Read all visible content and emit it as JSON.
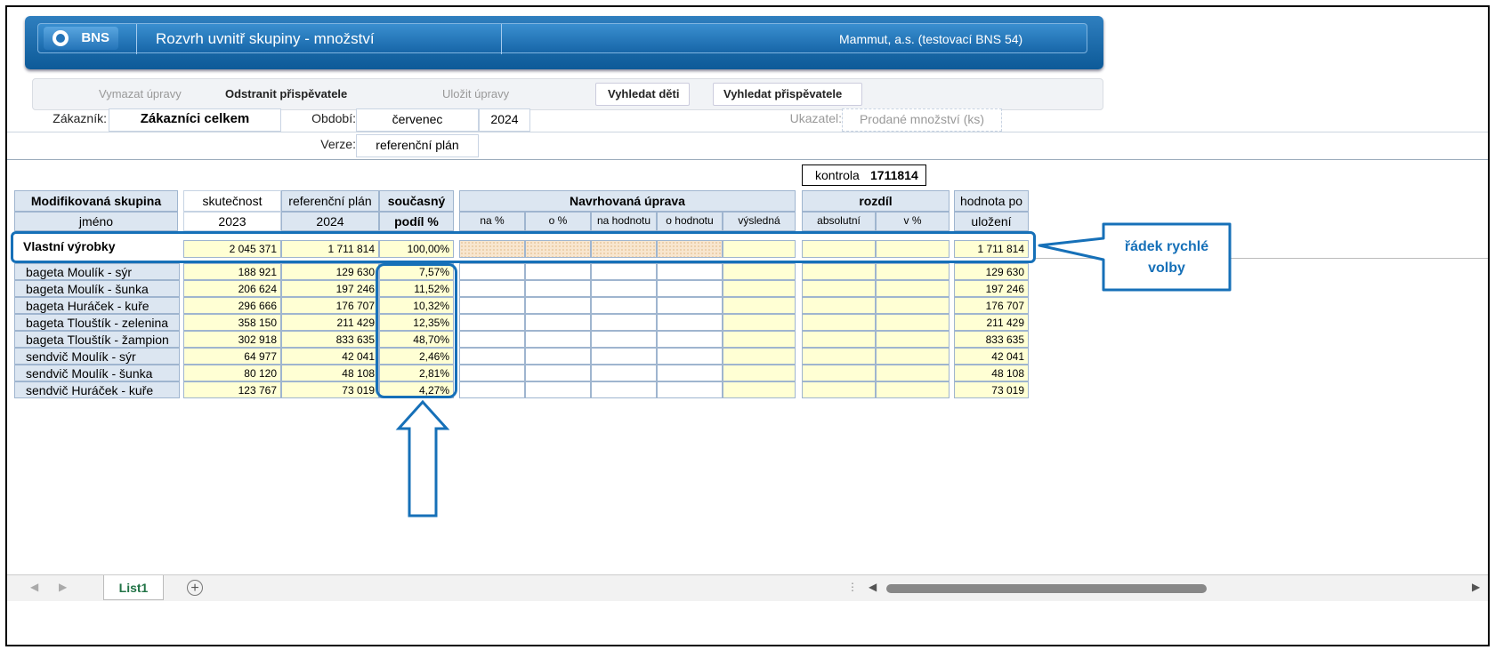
{
  "header": {
    "logo_text": "BNS",
    "app_title": "Rozvrh uvnitř skupiny - množství",
    "company": "Mammut, a.s. (testovací BNS 54)"
  },
  "toolbar": {
    "clear": "Vymazat úpravy",
    "remove_contrib": "Odstranit přispěvatele",
    "save": "Uložit úpravy",
    "find_children": "Vyhledat děti",
    "find_contrib": "Vyhledat přispěvatele"
  },
  "form": {
    "customer_label": "Zákazník:",
    "customer_value": "Zákazníci celkem",
    "period_label": "Období:",
    "period_month": "červenec",
    "period_year": "2024",
    "indicator_label": "Ukazatel:",
    "indicator_value": "Prodané množství (ks)",
    "version_label": "Verze:",
    "version_value": "referenční plán"
  },
  "control": {
    "label": "kontrola",
    "value": "1711814"
  },
  "table": {
    "headers": {
      "group": "Modifikovaná skupina",
      "name": "jméno",
      "actual": "skutečnost",
      "actual_year": "2023",
      "ref_plan": "referenční plán",
      "ref_year": "2024",
      "share": "současný",
      "share2": "podíl %",
      "proposed": "Navrhovaná úprava",
      "na_pct": "na %",
      "o_pct": "o %",
      "na_val": "na hodnotu",
      "o_val": "o hodnotu",
      "result": "výsledná",
      "diff": "rozdíl",
      "absolute": "absolutní",
      "v_pct": "v %",
      "after_save": "hodnota po",
      "after_save2": "uložení"
    },
    "quick_row": {
      "name": "Vlastní výrobky",
      "actual": "2 045 371",
      "ref": "1 711 814",
      "share": "100,00%",
      "after": "1 711 814"
    },
    "rows": [
      {
        "name": "bageta Moulík - sýr",
        "actual": "188 921",
        "ref": "129 630",
        "share": "7,57%",
        "after": "129 630"
      },
      {
        "name": "bageta Moulík - šunka",
        "actual": "206 624",
        "ref": "197 246",
        "share": "11,52%",
        "after": "197 246"
      },
      {
        "name": "bageta Huráček - kuře",
        "actual": "296 666",
        "ref": "176 707",
        "share": "10,32%",
        "after": "176 707"
      },
      {
        "name": "bageta Tlouštík - zelenina",
        "actual": "358 150",
        "ref": "211 429",
        "share": "12,35%",
        "after": "211 429"
      },
      {
        "name": "bageta Tlouštík - žampion",
        "actual": "302 918",
        "ref": "833 635",
        "share": "48,70%",
        "after": "833 635"
      },
      {
        "name": "sendvič Moulík - sýr",
        "actual": "64 977",
        "ref": "42 041",
        "share": "2,46%",
        "after": "42 041"
      },
      {
        "name": "sendvič Moulík - šunka",
        "actual": "80 120",
        "ref": "48 108",
        "share": "2,81%",
        "after": "48 108"
      },
      {
        "name": "sendvič Huráček - kuře",
        "actual": "123 767",
        "ref": "73 019",
        "share": "4,27%",
        "after": "73 019"
      }
    ]
  },
  "annotation": {
    "line1": "řádek rychlé",
    "line2": "volby"
  },
  "sheet": {
    "tab": "List1"
  },
  "colors": {
    "accent": "#1670b8",
    "header_blue": "#0d5a98",
    "sheet_green": "#217346"
  }
}
